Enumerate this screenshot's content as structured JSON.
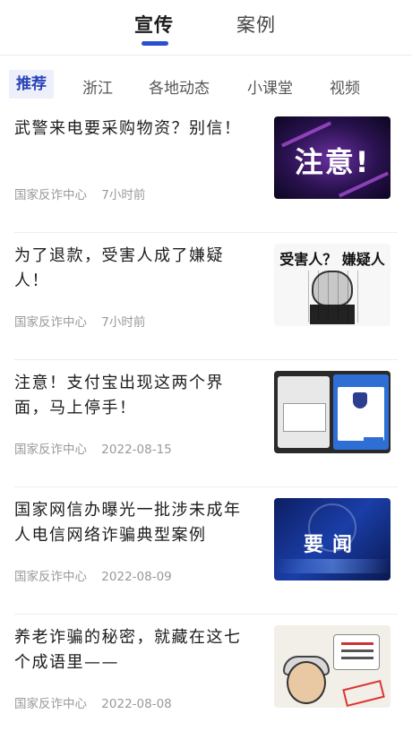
{
  "top_tabs": [
    {
      "label": "宣传",
      "active": true
    },
    {
      "label": "案例",
      "active": false
    }
  ],
  "categories": [
    {
      "label": "推荐",
      "active": true
    },
    {
      "label": "浙江",
      "active": false
    },
    {
      "label": "各地动态",
      "active": false
    },
    {
      "label": "小课堂",
      "active": false
    },
    {
      "label": "视频",
      "active": false
    }
  ],
  "articles": [
    {
      "title": "武警来电要采购物资？别信！",
      "source": "国家反诈中心",
      "time": "7小时前",
      "thumb_text": "注意!"
    },
    {
      "title": "为了退款，受害人成了嫌疑人！",
      "source": "国家反诈中心",
      "time": "7小时前",
      "thumb_text": "受害人？ 嫌疑人"
    },
    {
      "title": "注意！支付宝出现这两个界面，马上停手！",
      "source": "国家反诈中心",
      "time": "2022-08-15",
      "thumb_text": ""
    },
    {
      "title": "国家网信办曝光一批涉未成年人电信网络诈骗典型案例",
      "source": "国家反诈中心",
      "time": "2022-08-09",
      "thumb_text": "要闻"
    },
    {
      "title": "养老诈骗的秘密，就藏在这七个成语里——",
      "source": "国家反诈中心",
      "time": "2022-08-08",
      "thumb_text": ""
    }
  ],
  "colors": {
    "accent": "#2a4fd0",
    "category_active_bg": "#edf0fa",
    "meta_text": "#999999"
  }
}
